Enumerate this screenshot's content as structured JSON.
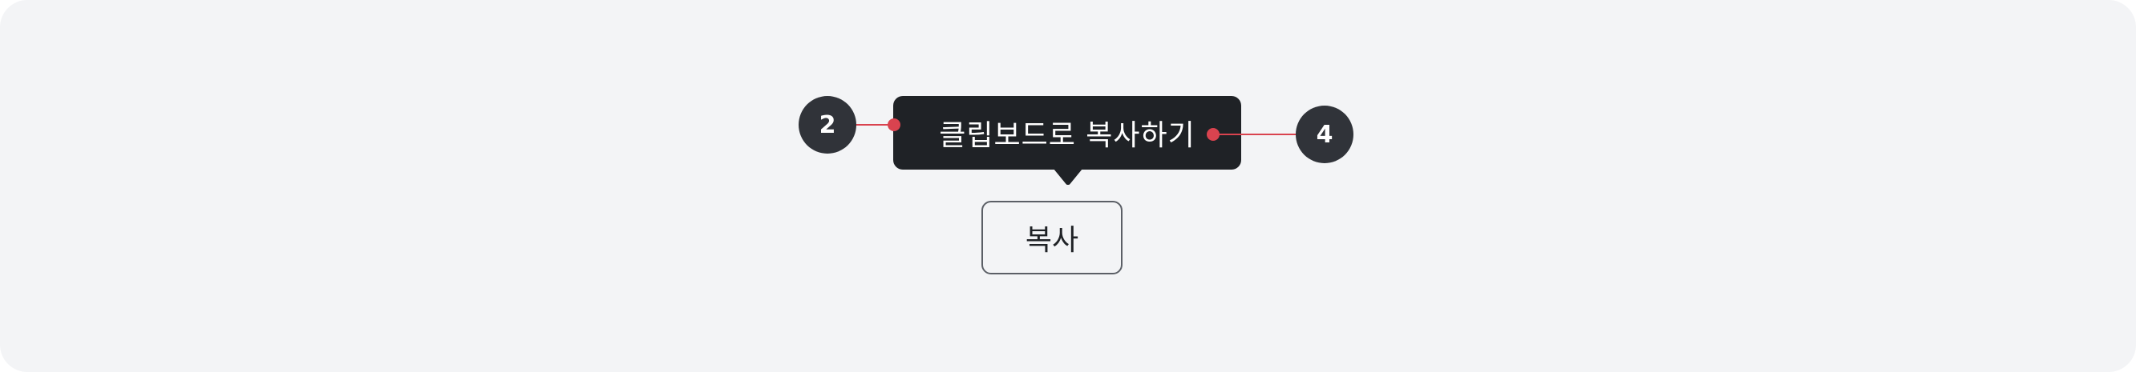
{
  "tooltip": {
    "text": "클립보드로 복사하기"
  },
  "button": {
    "label": "복사"
  },
  "annotations": [
    {
      "number": "2"
    },
    {
      "number": "4"
    }
  ],
  "colors": {
    "background": "#f3f4f6",
    "tooltip_background": "#1f2226",
    "marker_background": "#303339",
    "connector": "#d9434f",
    "button_border": "#5b5f66"
  }
}
